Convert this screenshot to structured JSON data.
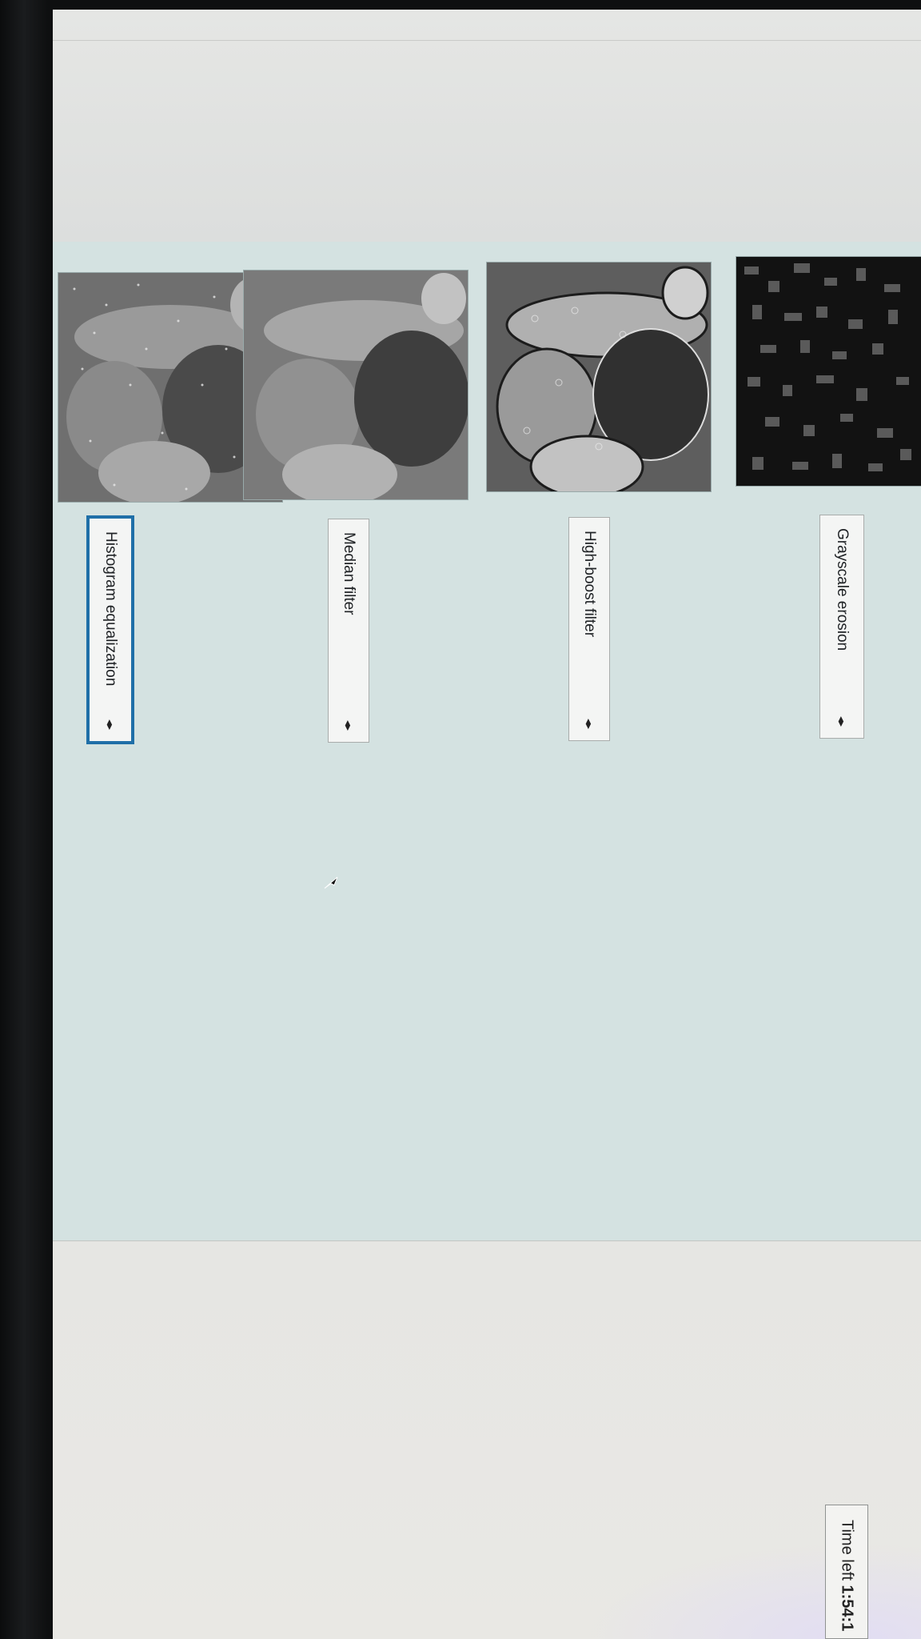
{
  "quiz": {
    "items": [
      {
        "label": "Histogram equalization",
        "image": "peppers-noisy-image",
        "focused": true
      },
      {
        "label": "Median filter",
        "image": "peppers-smooth-image",
        "focused": false
      },
      {
        "label": "High-boost filter",
        "image": "peppers-sharpened-image",
        "focused": false
      },
      {
        "label": "Grayscale erosion",
        "image": "peppers-eroded-image",
        "focused": false
      }
    ]
  },
  "timer": {
    "prefix": "Time left ",
    "value": "1:54:1"
  },
  "icons": {
    "select": "updown-arrows-icon",
    "pointer": "mouse-pointer-icon"
  },
  "colors": {
    "focus_border": "#1f6fa8",
    "panel": "#d4e2e1"
  }
}
